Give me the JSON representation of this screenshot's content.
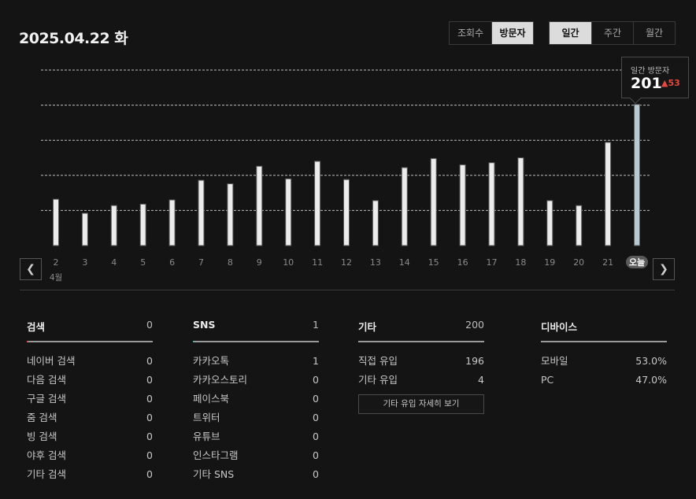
{
  "header": {
    "date": "2025.04.22 화"
  },
  "metric_toggle": {
    "options": [
      "조회수",
      "방문자"
    ],
    "selected": "방문자"
  },
  "period_toggle": {
    "options": [
      "일간",
      "주간",
      "월간"
    ],
    "selected": "일간"
  },
  "tooltip": {
    "label": "일간 방문자",
    "value": "201",
    "delta": "53"
  },
  "chart_data": {
    "type": "bar",
    "categories": [
      "2",
      "3",
      "4",
      "5",
      "6",
      "7",
      "8",
      "9",
      "10",
      "11",
      "12",
      "13",
      "14",
      "15",
      "16",
      "17",
      "18",
      "19",
      "20",
      "21",
      "오늘"
    ],
    "month_label": "4월",
    "values": [
      66,
      46,
      57,
      59,
      65,
      93,
      88,
      113,
      95,
      120,
      94,
      64,
      111,
      124,
      115,
      118,
      125,
      64,
      57,
      147,
      201
    ],
    "ylim": [
      0,
      250
    ],
    "grid_lines": [
      50,
      100,
      150,
      200,
      250
    ],
    "grid": true,
    "highlight_index": 20,
    "colors": {
      "bar_fill": "#ececec",
      "bar_outline": "#5a5a5a",
      "highlight_fill": "#b9c9d3",
      "new_visitor": "#c0392b"
    }
  },
  "stats": [
    {
      "title": "검색",
      "total": "0",
      "accent": "#e4514c",
      "rows": [
        {
          "label": "네이버 검색",
          "value": "0"
        },
        {
          "label": "다음 검색",
          "value": "0"
        },
        {
          "label": "구글 검색",
          "value": "0"
        },
        {
          "label": "줌 검색",
          "value": "0"
        },
        {
          "label": "빙 검색",
          "value": "0"
        },
        {
          "label": "야후 검색",
          "value": "0"
        },
        {
          "label": "기타 검색",
          "value": "0"
        }
      ]
    },
    {
      "title": "SNS",
      "total": "1",
      "accent": "#4db6ac",
      "rows": [
        {
          "label": "카카오톡",
          "value": "1"
        },
        {
          "label": "카카오스토리",
          "value": "0"
        },
        {
          "label": "페이스북",
          "value": "0"
        },
        {
          "label": "트위터",
          "value": "0"
        },
        {
          "label": "유튜브",
          "value": "0"
        },
        {
          "label": "인스타그램",
          "value": "0"
        },
        {
          "label": "기타 SNS",
          "value": "0"
        }
      ]
    },
    {
      "title": "기타",
      "total": "200",
      "accent": "#9a9a9a",
      "rows": [
        {
          "label": "직접 유입",
          "value": "196"
        },
        {
          "label": "기타 유입",
          "value": "4"
        }
      ],
      "button": "기타 유입 자세히 보기"
    },
    {
      "title": "디바이스",
      "total": "",
      "accent": "#9a9a9a",
      "rows": [
        {
          "label": "모바일",
          "value": "53.0%"
        },
        {
          "label": "PC",
          "value": "47.0%"
        }
      ]
    }
  ]
}
